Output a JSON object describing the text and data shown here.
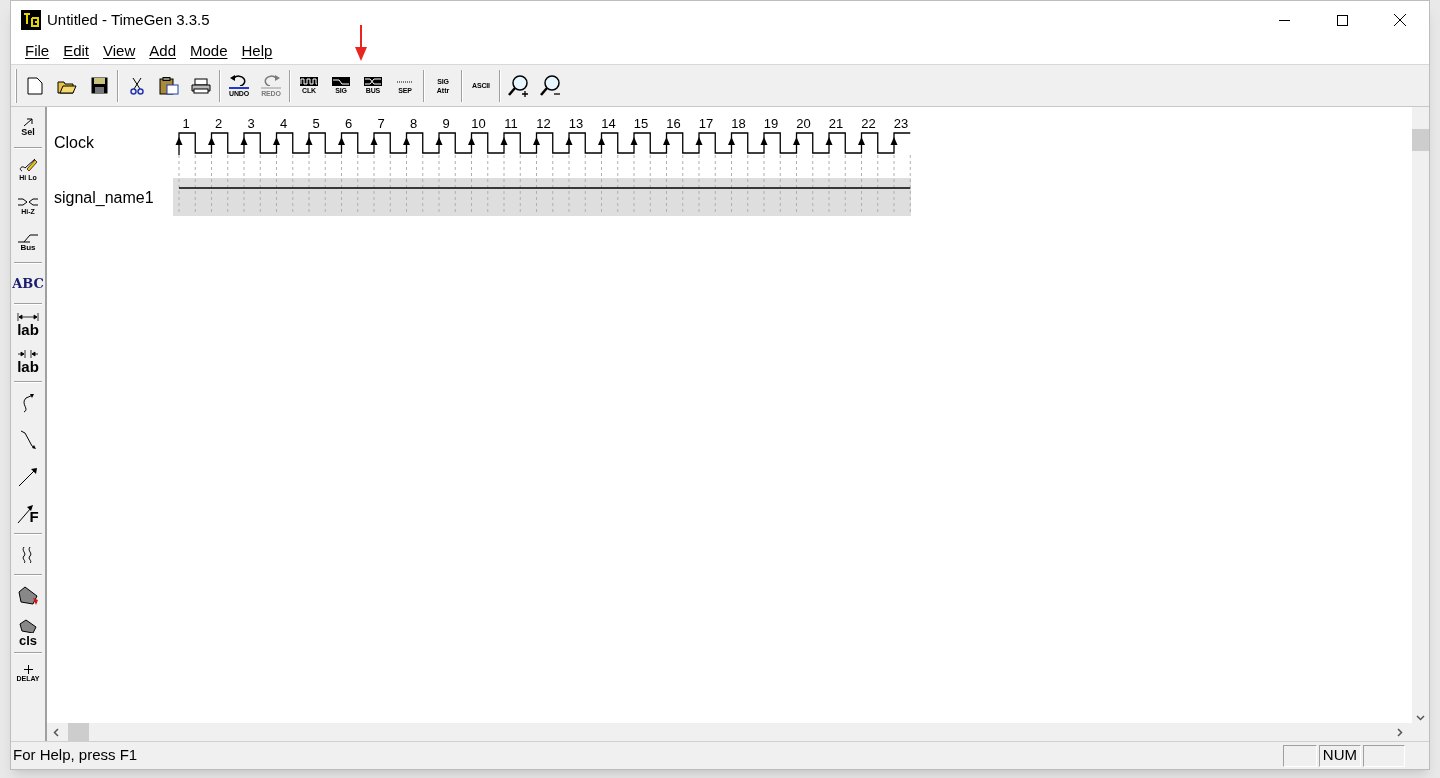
{
  "window": {
    "title": "Untitled - TimeGen 3.3.5"
  },
  "menu": [
    {
      "label": "File"
    },
    {
      "label": "Edit"
    },
    {
      "label": "View"
    },
    {
      "label": "Add"
    },
    {
      "label": "Mode"
    },
    {
      "label": "Help"
    }
  ],
  "toolbar_groups": [
    {
      "tools": [
        {
          "kind": "new",
          "disabled": false
        },
        {
          "kind": "open",
          "disabled": false
        },
        {
          "kind": "save",
          "disabled": false
        }
      ]
    },
    {
      "tools": [
        {
          "kind": "cut",
          "disabled": false
        },
        {
          "kind": "paste",
          "disabled": false
        },
        {
          "kind": "print",
          "disabled": false
        }
      ]
    },
    {
      "tools": [
        {
          "kind": "undo",
          "label": "UNDO",
          "disabled": false
        },
        {
          "kind": "redo",
          "label": "REDO",
          "disabled": true
        }
      ]
    },
    {
      "tools": [
        {
          "kind": "clk",
          "label": "CLK",
          "disabled": false
        },
        {
          "kind": "sig",
          "label": "SIG",
          "disabled": false
        },
        {
          "kind": "bus",
          "label": "BUS",
          "disabled": false
        },
        {
          "kind": "sep",
          "label": "SEP",
          "disabled": false
        }
      ]
    },
    {
      "tools": [
        {
          "kind": "text2",
          "label": "SIG",
          "label2": "Attr",
          "disabled": false
        }
      ]
    },
    {
      "tools": [
        {
          "kind": "text1",
          "label": "ASCII",
          "disabled": false
        }
      ]
    },
    {
      "tools": [
        {
          "kind": "zoomin",
          "disabled": false
        },
        {
          "kind": "zoomout",
          "disabled": false
        }
      ]
    }
  ],
  "tool_groups": [
    {
      "tools": [
        {
          "kind": "select",
          "label": "Sel"
        }
      ]
    },
    {
      "tools": [
        {
          "kind": "hilo",
          "label": "Hi Lo"
        },
        {
          "kind": "hiz",
          "label": "Hi-Z"
        },
        {
          "kind": "bus",
          "label": "Bus"
        }
      ]
    },
    {
      "tools": [
        {
          "kind": "text",
          "label": "ABC"
        }
      ]
    },
    {
      "tools": [
        {
          "kind": "lab-span",
          "label": "lab"
        },
        {
          "kind": "lab-in",
          "label": "lab"
        }
      ]
    },
    {
      "tools": [
        {
          "kind": "curve"
        },
        {
          "kind": "bent"
        },
        {
          "kind": "arrow"
        },
        {
          "kind": "arrow-f",
          "label": "F"
        }
      ]
    },
    {
      "tools": [
        {
          "kind": "break"
        }
      ]
    },
    {
      "tools": [
        {
          "kind": "tag"
        },
        {
          "kind": "tag-cls",
          "label": "cls"
        }
      ]
    },
    {
      "tools": [
        {
          "kind": "delay",
          "label": "DELAY"
        }
      ]
    }
  ],
  "diagram": {
    "ticks": [
      "1",
      "2",
      "3",
      "4",
      "5",
      "6",
      "7",
      "8",
      "9",
      "10",
      "11",
      "12",
      "13",
      "14",
      "15",
      "16",
      "17",
      "18",
      "19",
      "20",
      "21",
      "22",
      "23"
    ],
    "signals": [
      {
        "name": "Clock",
        "kind": "clock",
        "selected": false
      },
      {
        "name": "signal_name1",
        "kind": "signal",
        "selected": true
      }
    ]
  },
  "status_bar": {
    "text": "For Help, press F1",
    "indicators": [
      "NUM"
    ]
  }
}
